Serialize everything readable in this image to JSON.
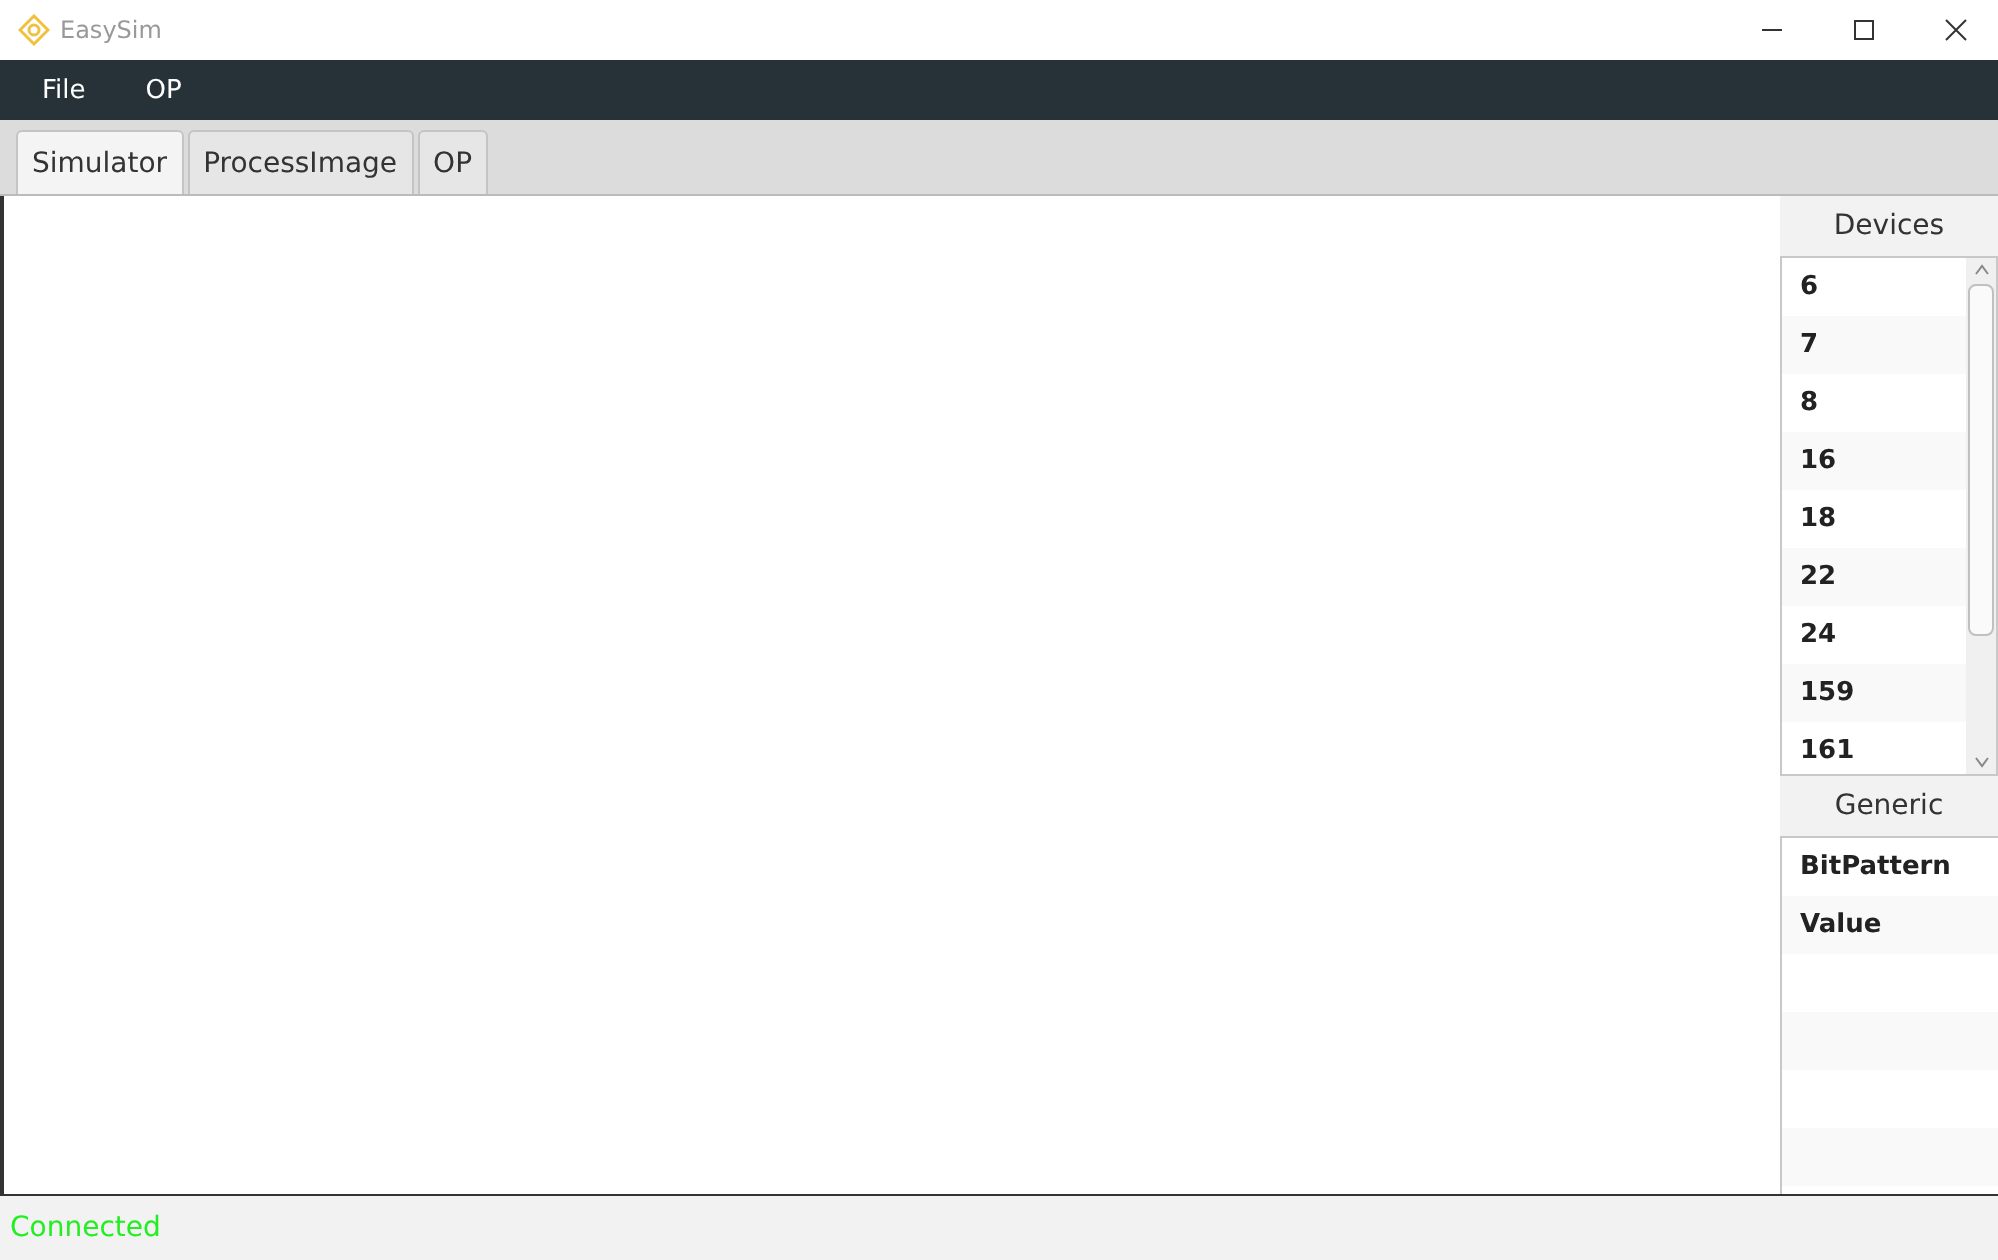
{
  "window": {
    "title": "EasySim"
  },
  "menu": [
    "File",
    "OP"
  ],
  "tabs": [
    {
      "label": "Simulator",
      "selected": true
    },
    {
      "label": "ProcessImage",
      "selected": false
    },
    {
      "label": "OP",
      "selected": false
    }
  ],
  "devices": {
    "title": "Devices",
    "items": [
      "6",
      "7",
      "8",
      "16",
      "18",
      "22",
      "24",
      "159",
      "161"
    ]
  },
  "generic": {
    "title": "Generic",
    "items": [
      "BitPattern",
      "Value"
    ]
  },
  "status_bar": {
    "text": "Connected"
  }
}
